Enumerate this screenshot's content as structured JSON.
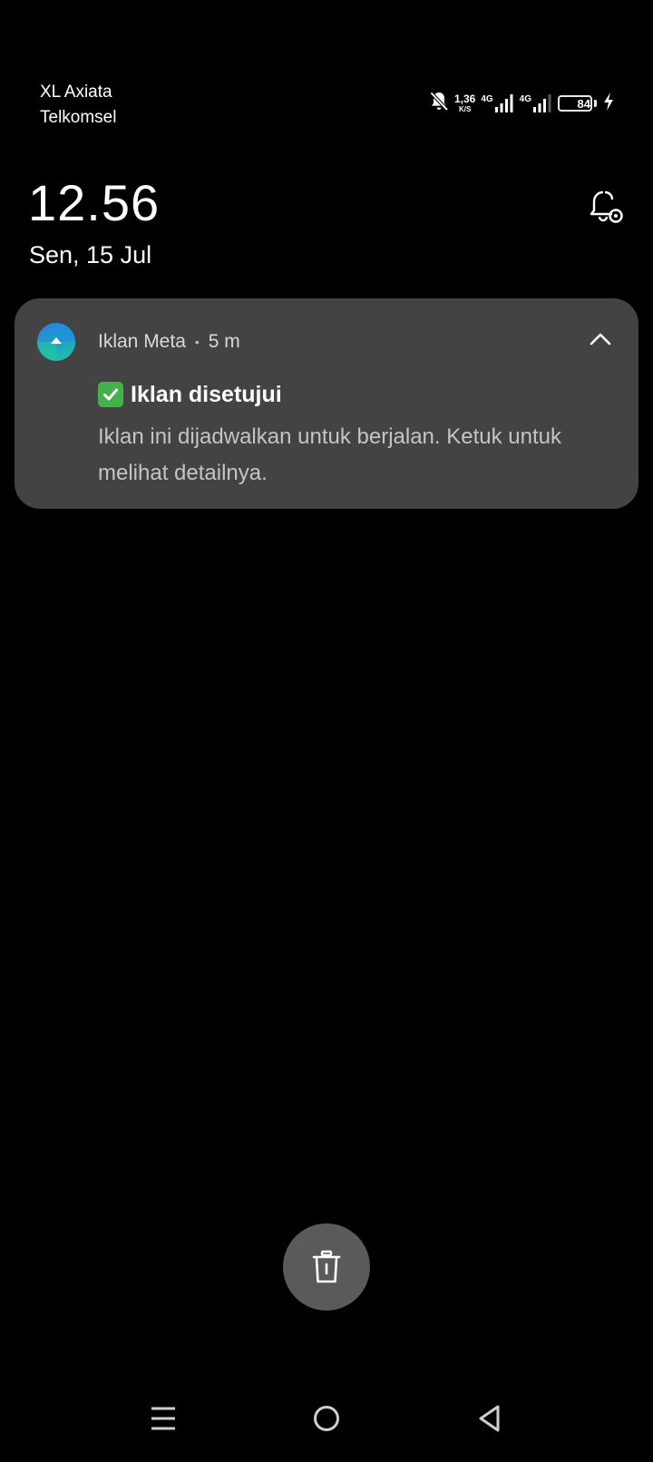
{
  "status_bar": {
    "carrier_1": "XL Axiata",
    "carrier_2": "Telkomsel",
    "net_speed": "1,36",
    "net_speed_unit": "K/S",
    "sim1_network": "4G",
    "sim2_network": "4G",
    "battery_level": "84",
    "battery_fraction": 0.84,
    "icons": [
      "bell-off-icon",
      "signal-icon",
      "battery-icon",
      "charging-icon"
    ]
  },
  "lockscreen": {
    "time": "12.56",
    "date": "Sen, 15 Jul"
  },
  "notification": {
    "app_name": "Iklan Meta",
    "separator": "•",
    "time_ago": "5 m",
    "title": "Iklan disetujui",
    "body": "Iklan ini dijadwalkan untuk berjalan. Ketuk untuk melihat detailnya.",
    "title_icon": "check-mark-button-icon",
    "expanded": true
  },
  "colors": {
    "background": "#000000",
    "card": "#434343",
    "clear_button": "#5a5a5a",
    "check_green": "#44b14a"
  },
  "nav": {
    "icons": [
      "menu-icon",
      "home-icon",
      "back-icon"
    ]
  }
}
